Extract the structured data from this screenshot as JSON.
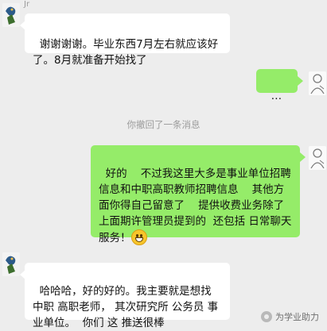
{
  "chat": {
    "sender_name": "Jr",
    "messages": [
      {
        "side": "in",
        "text": "谢谢谢谢。毕业东西7月左右就应该好了。8月就准备开始找了"
      },
      {
        "side": "out",
        "text": "…"
      },
      {
        "side": "out",
        "text": "好的    不过我这里大多是事业单位招聘信息和中职高职教师招聘信息    其他方面你得自己留意了    提供收费业务除了上面期许管理员提到的  还包括 日常聊天服务！"
      },
      {
        "side": "in",
        "text": "哈哈哈，好的好的。我主要就是想找 中职 高职老师， 其次研究所 公务员 事业单位。  你们 这 推送很棒"
      }
    ],
    "system_notice": "你撤回了一条消息"
  },
  "watermark": {
    "text": "为学业助力",
    "icon": "wechat-official-account-icon"
  },
  "colors": {
    "incoming": "#ffffff",
    "outgoing": "#95ec69",
    "background": "#ededed"
  }
}
